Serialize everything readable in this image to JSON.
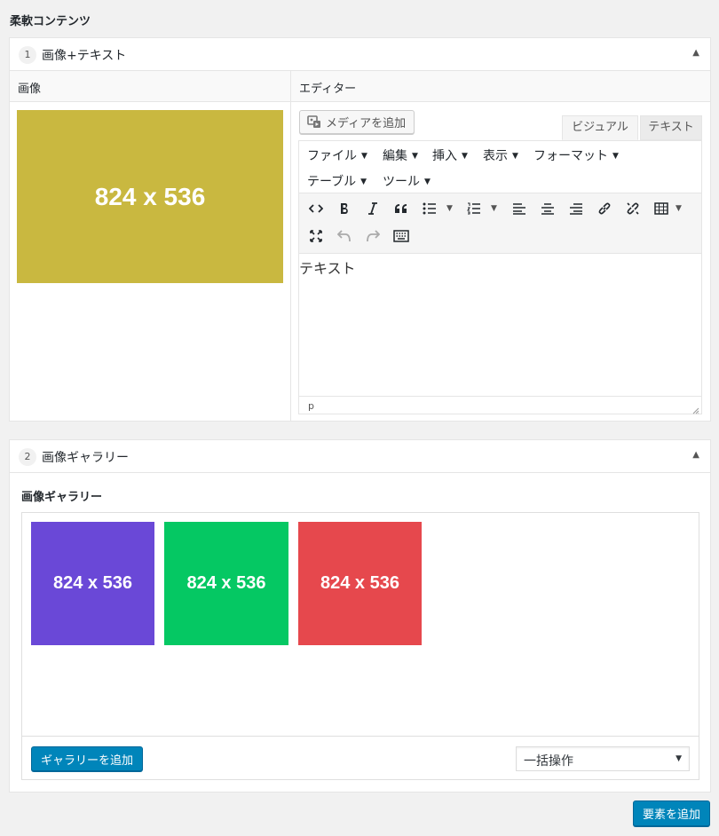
{
  "page": {
    "title": "柔軟コンテンツ"
  },
  "layout1": {
    "order": "1",
    "title": "画像+テキスト",
    "toggle_icon": "▲",
    "image_field": {
      "label": "画像",
      "placeholder_text": "824 x 536",
      "placeholder_color": "#c9b840"
    },
    "editor_field": {
      "label": "エディター",
      "add_media_label": "メディアを追加",
      "tabs": {
        "visual": "ビジュアル",
        "text": "テキスト"
      },
      "menus": [
        {
          "label": "ファイル"
        },
        {
          "label": "編集"
        },
        {
          "label": "挿入"
        },
        {
          "label": "表示"
        },
        {
          "label": "フォーマット"
        },
        {
          "label": "テーブル"
        },
        {
          "label": "ツール"
        }
      ],
      "toolbar_icons": [
        "code-icon",
        "bold-icon",
        "italic-icon",
        "blockquote-icon",
        "bullet-list-icon",
        "numbered-list-icon",
        "align-left-icon",
        "align-center-icon",
        "align-right-icon",
        "link-icon",
        "unlink-icon",
        "table-icon",
        "fullscreen-icon",
        "undo-icon",
        "redo-icon",
        "keyboard-icon"
      ],
      "content": "テキスト",
      "path": "p"
    }
  },
  "layout2": {
    "order": "2",
    "title": "画像ギャラリー",
    "toggle_icon": "▲",
    "gallery_label": "画像ギャラリー",
    "images": [
      {
        "text": "824 x 536",
        "color": "#6a48d7"
      },
      {
        "text": "824 x 536",
        "color": "#05c863"
      },
      {
        "text": "824 x 536",
        "color": "#e6484d"
      }
    ],
    "add_gallery_label": "ギャラリーを追加",
    "bulk_action": {
      "selected": "一括操作"
    }
  },
  "footer": {
    "add_element_label": "要素を追加"
  },
  "colors": {
    "accent": "#0085ba",
    "border": "#e5e5e5",
    "background": "#f1f1f1"
  }
}
